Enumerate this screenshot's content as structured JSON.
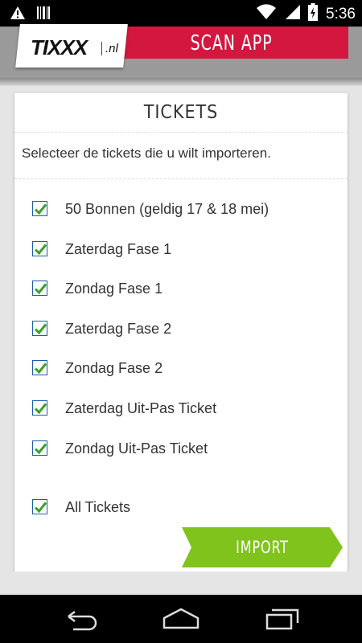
{
  "status_bar": {
    "time": "5:36",
    "icons": [
      "warning-icon",
      "barcode-icon",
      "wifi-icon",
      "signal-icon",
      "battery-charging-icon"
    ]
  },
  "header": {
    "logo_main": "TIXXX",
    "logo_suffix": ".nl",
    "banner_title": "SCAN APP",
    "banner_color": "#d3173f"
  },
  "card": {
    "title": "TICKETS",
    "subtitle": "Selecteer de tickets die u wilt importeren.",
    "tickets": [
      {
        "label": "50 Bonnen (geldig 17 & 18 mei)",
        "checked": true
      },
      {
        "label": "Zaterdag Fase 1",
        "checked": true
      },
      {
        "label": "Zondag Fase 1",
        "checked": true
      },
      {
        "label": "Zaterdag Fase 2",
        "checked": true
      },
      {
        "label": "Zondag Fase 2",
        "checked": true
      },
      {
        "label": "Zaterdag Uit-Pas Ticket",
        "checked": true
      },
      {
        "label": "Zondag Uit-Pas Ticket",
        "checked": true
      }
    ],
    "all_tickets": {
      "label": "All Tickets",
      "checked": true
    },
    "import_label": "IMPORT",
    "import_color": "#7fc31c",
    "check_color": "#3aa12a"
  },
  "nav": {
    "icons": [
      "back-icon",
      "home-icon",
      "recent-apps-icon"
    ]
  }
}
